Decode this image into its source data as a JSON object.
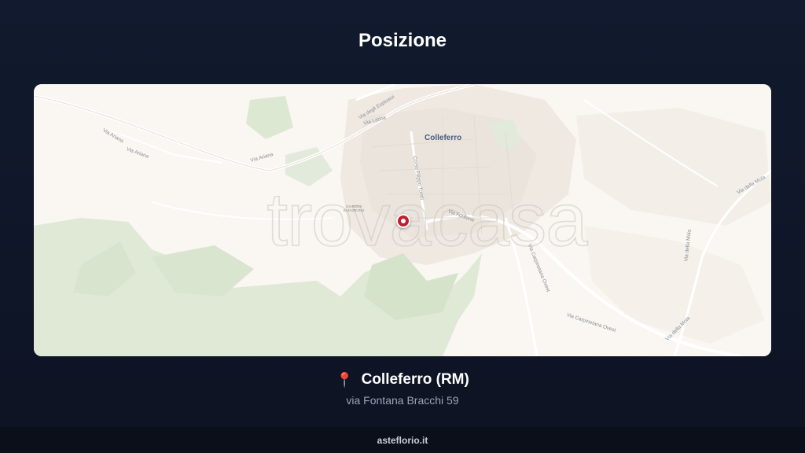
{
  "page": {
    "title": "Posizione"
  },
  "map": {
    "watermark": "trovacasa",
    "city_label": "Colleferro",
    "streets": [
      {
        "name": "Via degli Esplosivi"
      },
      {
        "name": "Via Latina"
      },
      {
        "name": "Via Ariana"
      },
      {
        "name": "Via Ariana"
      },
      {
        "name": "Via Ariana"
      },
      {
        "name": "Corso Filippo Turati"
      },
      {
        "name": "Via Fontana"
      },
      {
        "name": "Via Carpinetana Ovest"
      },
      {
        "name": "Via Carpinetana Ovest"
      },
      {
        "name": "Via della Mola"
      },
      {
        "name": "Via della Mola"
      },
      {
        "name": "Via della Mola"
      }
    ],
    "poi": "GIARDINI SAN BRUNO",
    "colors": {
      "land": "#faf6f1",
      "urban": "#efe9e2",
      "green": "#dfe9d6",
      "road": "#ffffff",
      "marker": "#c0202e"
    }
  },
  "location": {
    "icon": "map-pin-icon",
    "name": "Colleferro (RM)",
    "address": "via Fontana Bracchi 59"
  },
  "footer": {
    "text": "asteflorio.it"
  }
}
